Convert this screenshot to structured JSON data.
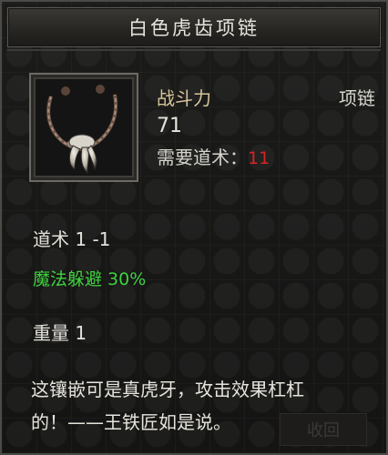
{
  "tooltip": {
    "title": "白色虎齿项链",
    "power_label": "战斗力",
    "power_value": "71",
    "category": "项链",
    "requirement_label": "需要道术：",
    "requirement_value": "11",
    "stat_daoshu": "道术 1 -1",
    "stat_magic_dodge": "魔法躲避 30%",
    "stat_weight": "重量 1",
    "description_line1": "这镶嵌可是真虎牙，攻击效果杠杠",
    "description_line2": "的！——王铁匠如是说。",
    "ghost_button": "收回"
  },
  "colors": {
    "power_label": "#d6c59a",
    "requirement_value": "#d82424",
    "magic_dodge": "#3fd13f"
  },
  "icons": {
    "item": "tiger-tooth-necklace-icon"
  }
}
